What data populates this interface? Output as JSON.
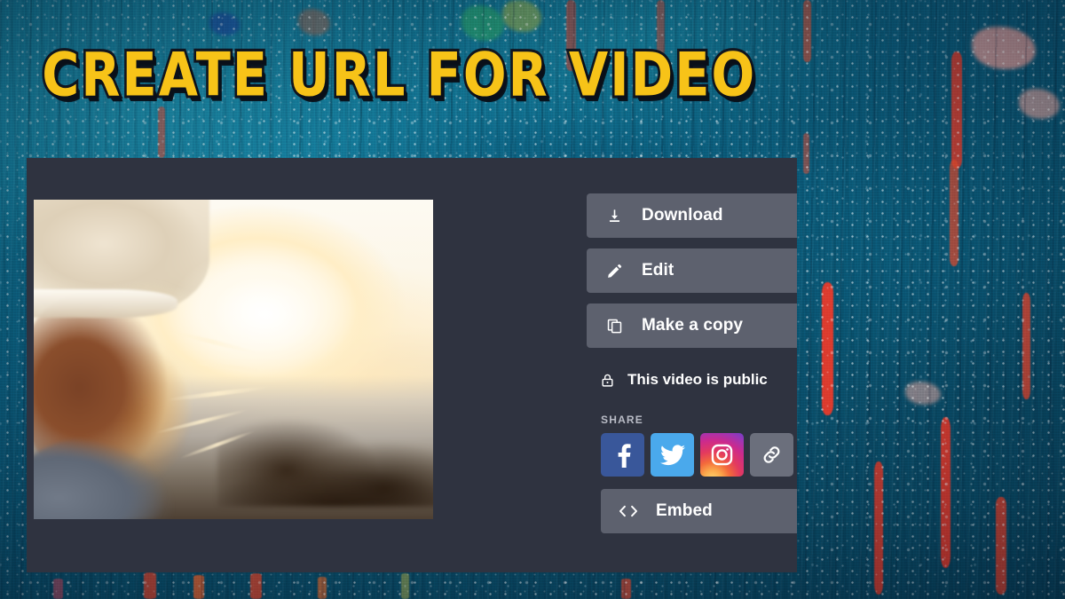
{
  "title": {
    "text": "CREATE URL FOR VIDEO",
    "color": "#F7C318",
    "outline_color": "#10151f"
  },
  "theme": {
    "panel_bg": "#2f3340",
    "button_bg": "#5d616e",
    "text_color": "#ffffff",
    "muted_text": "#b9bcc6",
    "background_description": "abstract teal painted canvas with red, orange, pink and white paint spatter"
  },
  "panel": {
    "video_preview": {
      "name": "video-thumbnail",
      "description": "blurred video still of a woman with long hair wearing a knit beanie, backlit by a golden sunset over the coast"
    },
    "actions": [
      {
        "icon": "download-icon",
        "label": "Download"
      },
      {
        "icon": "pencil-icon",
        "label": "Edit"
      },
      {
        "icon": "copy-icon",
        "label": "Make a copy"
      }
    ],
    "privacy": {
      "icon": "lock-icon",
      "label": "This video is public"
    },
    "share": {
      "label": "SHARE",
      "targets": [
        {
          "name": "facebook",
          "glyph": "f",
          "color": "#39579a"
        },
        {
          "name": "twitter",
          "glyph": "bird",
          "color": "#4aa9ec"
        },
        {
          "name": "instagram",
          "glyph": "camera",
          "color": "#cc2a8d"
        },
        {
          "name": "copy-link",
          "glyph": "link",
          "color": "#6b6f7c"
        }
      ]
    },
    "embed": {
      "icon": "code-icon",
      "label": "Embed"
    }
  }
}
